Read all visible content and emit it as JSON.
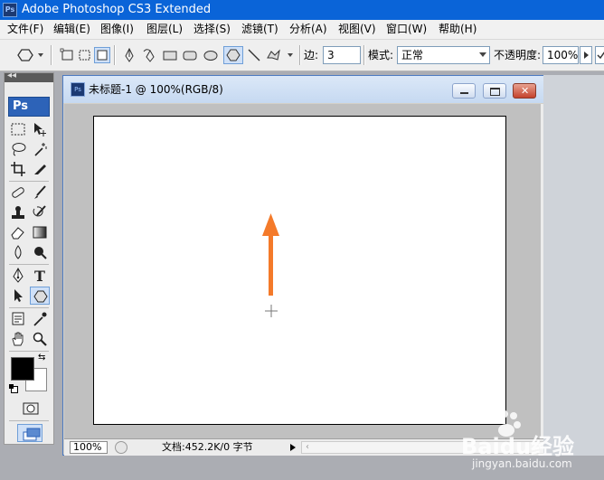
{
  "app": {
    "title": "Adobe Photoshop CS3 Extended",
    "logo": "Ps"
  },
  "menu": [
    "文件(F)",
    "编辑(E)",
    "图像(I)",
    "图层(L)",
    "选择(S)",
    "滤镜(T)",
    "分析(A)",
    "视图(V)",
    "窗口(W)",
    "帮助(H)"
  ],
  "options": {
    "sides_label": "边:",
    "sides_value": "3",
    "mode_label": "模式:",
    "mode_value": "正常",
    "opacity_label": "不透明度:",
    "opacity_value": "100%"
  },
  "document": {
    "title": "未标题-1 @ 100%(RGB/8)",
    "icon": "Ps",
    "zoom": "100%",
    "doc_info": "文档:452.2K/0 字节"
  },
  "watermark": {
    "brand": "Baidu经验",
    "url": "jingyan.baidu.com"
  },
  "colors": {
    "titlebar": "#0a64d8",
    "foreground": "#000000",
    "background": "#ffffff",
    "arrow": "#f47a2a",
    "selected_tool": "#cfe0f7"
  }
}
